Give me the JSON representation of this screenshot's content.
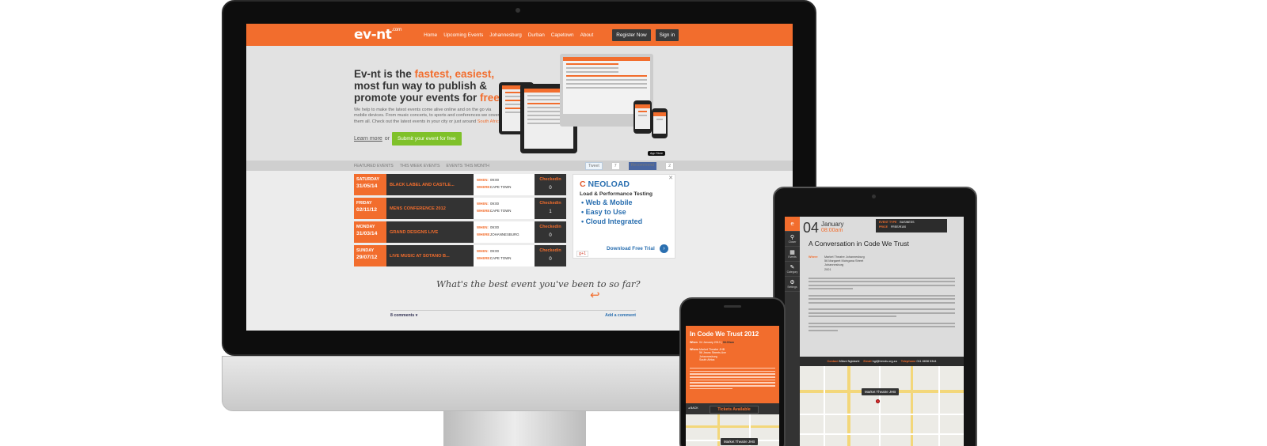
{
  "nav": {
    "logo": "ev-nt",
    "logo_suffix": ".com",
    "links": [
      "Home",
      "Upcoming Events",
      "Johannesburg",
      "Durban",
      "Capetown",
      "About"
    ],
    "register_label": "Register Now",
    "signin_label": "Sign in"
  },
  "hero": {
    "headline_1": "Ev-nt is the ",
    "headline_hl": "fastest, easiest,",
    "headline_2": "most fun way to publish &",
    "headline_3": "promote your events for ",
    "headline_free": "free",
    "headline_end": ".",
    "description": "We help to make the latest events come alive online and on the go via mobile devices. From music concerts, to sports and conferences we cover them all. Check out the latest events in your city or just around ",
    "description_hl": "South Africa",
    "description_end": ".",
    "learn_more": "Learn more",
    "or": "or",
    "submit_label": "Submit your event for free",
    "appstore": "App Store"
  },
  "tabs": {
    "items": [
      "FEATURED EVENTS",
      "THIS WEEK EVENTS",
      "EVENTS THIS MONTH"
    ],
    "tweet": "Tweet",
    "tweet_count": "7",
    "recommend": "Recommend",
    "recommend_count": "2"
  },
  "events": [
    {
      "day": "SATURDAY",
      "date": "31/05/14",
      "title": "BLACK LABEL AND CASTLE...",
      "when": "09:00",
      "where": "CAPE TOWN",
      "checkedin_label": "Checkedin",
      "count": "0"
    },
    {
      "day": "FRIDAY",
      "date": "02/11/12",
      "title": "MENS CONFERENCE 2012",
      "when": "09:00",
      "where": "CAPE TOWN",
      "checkedin_label": "Checkedin",
      "count": "1"
    },
    {
      "day": "MONDAY",
      "date": "31/03/14",
      "title": "GRAND DESIGNS LIVE",
      "when": "09:00",
      "where": "JOHANNESBURG",
      "checkedin_label": "Checkedin",
      "count": "0"
    },
    {
      "day": "SUNDAY",
      "date": "29/07/12",
      "title": "LIVE MUSIC AT SOTANO B...",
      "when": "09:00",
      "where": "CAPE TOWN",
      "checkedin_label": "Checkedin",
      "count": "0"
    }
  ],
  "labels": {
    "when": "WHEN:",
    "where": "WHERE:"
  },
  "ad": {
    "brand_c": "C",
    "brand": " NEOLOAD",
    "subtitle": "Load & Performance Testing",
    "items": [
      "• Web & Mobile",
      "• Easy to Use",
      "• Cloud Integrated"
    ],
    "download": "Download Free Trial",
    "gplus": "g+1",
    "close": "✕"
  },
  "comment_prompt": "What's the best event you've been to so far?",
  "comments": {
    "count": "8 comments ▾",
    "add": "Add a comment"
  },
  "ipad": {
    "day": "04",
    "month": "January",
    "time": "08:00am",
    "meta_1_k": "EVENT TYPE",
    "meta_1_v": "BUSINESS",
    "meta_2_k": "PRICE",
    "meta_2_v": "FREE/R100",
    "title": "A Conversation in Code We Trust",
    "where_label": "Where",
    "where_lines": [
      "Market Theatre Johannesburg",
      "56 Margaret Mcingana Street",
      "Johannesburg",
      "2001"
    ],
    "contact_label": "Contact",
    "contact_name": "Milani Ngidashi",
    "email_label": "Email",
    "email": "hgi@trends.org.za",
    "phone_label": "Telephone",
    "phone": "011 8838 5344",
    "map_label": "Market Theatre JHB",
    "side": [
      "Closer",
      "Events",
      "Category",
      "Settings"
    ]
  },
  "iphone": {
    "title": "In Code We Trust 2012",
    "when_label": "When",
    "when": "04 January 2013",
    "when_time": "08:00am",
    "where_label": "Where",
    "where_lines": [
      "Market Theatre JHB",
      "56 Jeans Streets Ave",
      "Johannesburg",
      "South Africa"
    ],
    "back": "◂ BACK",
    "tickets": "Tickets Available",
    "map_label": "Market Theatre JHB"
  }
}
